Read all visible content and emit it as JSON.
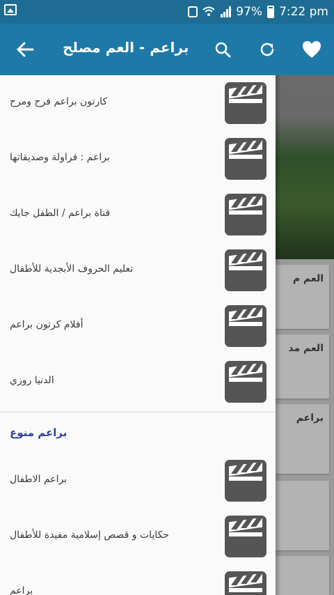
{
  "status_bar": {
    "battery": "97%",
    "time": "7:22 pm"
  },
  "app_bar": {
    "title": "براعم - العم مصلح",
    "icons": [
      "back-arrow-icon",
      "search-icon",
      "refresh-icon",
      "heart-icon"
    ]
  },
  "drawer": {
    "items": [
      {
        "label": "كارتون براعم فرح ومرح",
        "icon": "clapperboard-icon"
      },
      {
        "label": "براعم : فراولة وصديقاتها",
        "icon": "clapperboard-icon"
      },
      {
        "label": "قناة براعم / الطفل جايك",
        "icon": "clapperboard-icon"
      },
      {
        "label": "تعليم الحروف الأبجدية للأطفال",
        "icon": "clapperboard-icon"
      },
      {
        "label": "أفلام كرتون براعم",
        "icon": "clapperboard-icon"
      },
      {
        "label": "الدنيا روزي",
        "icon": "clapperboard-icon"
      }
    ],
    "section_title": "براعم منوع",
    "section_items": [
      {
        "label": "براعم الاطفال",
        "icon": "clapperboard-icon"
      },
      {
        "label": "حكايات و قصص إسلامية مفيدة للأطفال",
        "icon": "clapperboard-icon"
      },
      {
        "label": "براعم",
        "icon": "clapperboard-icon"
      }
    ]
  },
  "background": {
    "cards": [
      "العم م",
      "العم مد",
      "براعم"
    ]
  },
  "colors": {
    "status_bar": "#1e6c93",
    "app_bar": "#1f79a8",
    "section_title": "#2f3f9e",
    "thumbnail": "#555555"
  }
}
